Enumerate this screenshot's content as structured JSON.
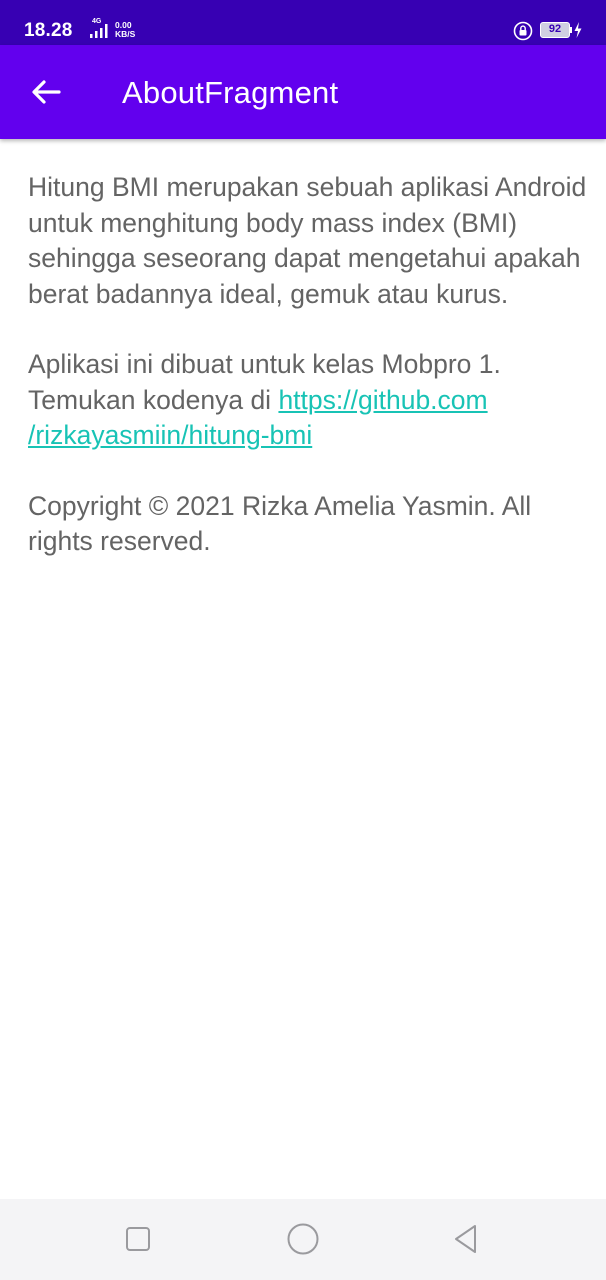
{
  "status_bar": {
    "time": "18.28",
    "network_type": "4G",
    "net_speed_value": "0.00",
    "net_speed_unit": "KB/S",
    "battery_level": "92",
    "icons": [
      "signal-icon",
      "lock-icon",
      "battery-icon",
      "charging-bolt-icon"
    ]
  },
  "app_bar": {
    "title": "AboutFragment",
    "back_icon": "arrow-back-icon",
    "background_color": "#6200ee"
  },
  "content": {
    "paragraph_1": "Hitung BMI merupakan sebuah aplikasi Android untuk menghitung body mass index (BMI) sehingga seseorang dapat mengetahui apakah berat badannya ideal, gemuk atau kurus.",
    "paragraph_2_prefix": "Aplikasi ini dibuat untuk kelas Mobpro 1. Temukan kodenya di ",
    "link_part_1": "https://github.com",
    "link_part_2": "/rizkayasmiin/hitung-bmi",
    "paragraph_3": "Copyright © 2021 Rizka Amelia Yasmin. All rights reserved.",
    "text_color": "#646464",
    "link_color": "#18c3b5"
  },
  "nav_bar": {
    "buttons": [
      "recents-square-icon",
      "home-circle-icon",
      "back-triangle-icon"
    ]
  },
  "colors": {
    "status_bar": "#3700b3",
    "app_bar": "#6200ee"
  }
}
